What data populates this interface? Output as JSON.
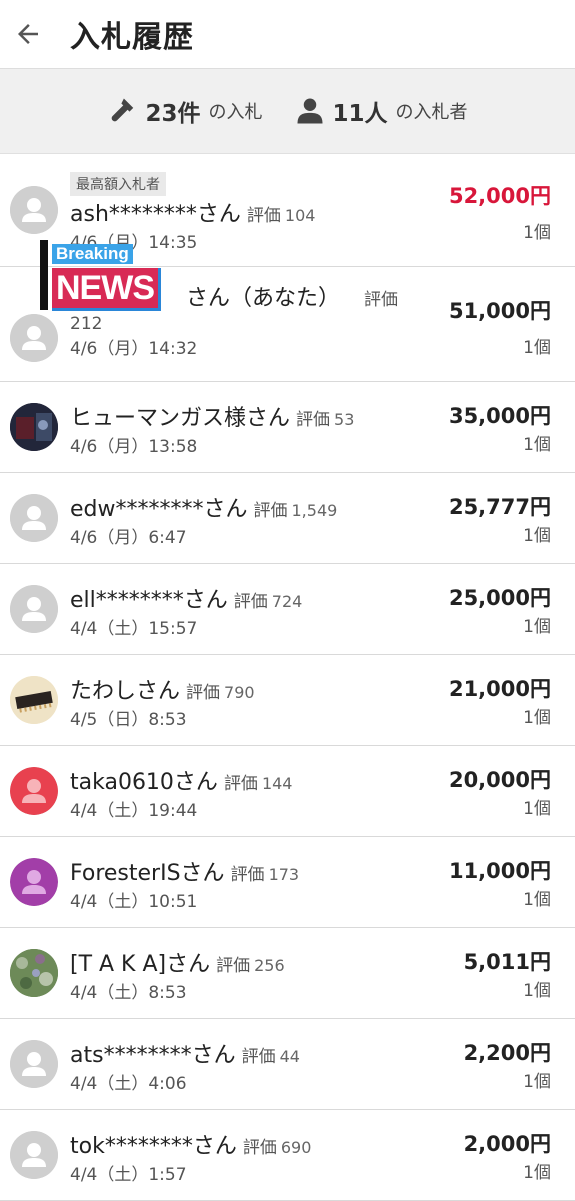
{
  "header": {
    "title": "入札履歴"
  },
  "summary": {
    "count_num": "23件",
    "count_label": "の入札",
    "bidders_num": "11人",
    "bidders_label": "の入札者"
  },
  "top_badge": "最高額入札者",
  "overlay": {
    "breaking": "Breaking",
    "news": "NEWS"
  },
  "bids": [
    {
      "name": "ash********さん",
      "rating_label": "評価",
      "rating": "104",
      "date": "4/6（月）14:35",
      "price": "52,000円",
      "qty": "1個"
    },
    {
      "name": "さん（あなた）",
      "rating_label": "評価",
      "rating": "212",
      "date": "4/6（月）14:32",
      "price": "51,000円",
      "qty": "1個"
    },
    {
      "name": "ヒューマンガス様さん",
      "rating_label": "評価",
      "rating": "53",
      "date": "4/6（月）13:58",
      "price": "35,000円",
      "qty": "1個"
    },
    {
      "name": "edw********さん",
      "rating_label": "評価",
      "rating": "1,549",
      "date": "4/6（月）6:47",
      "price": "25,777円",
      "qty": "1個"
    },
    {
      "name": "ell********さん",
      "rating_label": "評価",
      "rating": "724",
      "date": "4/4（土）15:57",
      "price": "25,000円",
      "qty": "1個"
    },
    {
      "name": "たわしさん",
      "rating_label": "評価",
      "rating": "790",
      "date": "4/5（日）8:53",
      "price": "21,000円",
      "qty": "1個"
    },
    {
      "name": "taka0610さん",
      "rating_label": "評価",
      "rating": "144",
      "date": "4/4（土）19:44",
      "price": "20,000円",
      "qty": "1個"
    },
    {
      "name": "ForesterISさん",
      "rating_label": "評価",
      "rating": "173",
      "date": "4/4（土）10:51",
      "price": "11,000円",
      "qty": "1個"
    },
    {
      "name": "[T A K A]さん",
      "rating_label": "評価",
      "rating": "256",
      "date": "4/4（土）8:53",
      "price": "5,011円",
      "qty": "1個"
    },
    {
      "name": "ats********さん",
      "rating_label": "評価",
      "rating": "44",
      "date": "4/4（土）4:06",
      "price": "2,200円",
      "qty": "1個"
    },
    {
      "name": "tok********さん",
      "rating_label": "評価",
      "rating": "690",
      "date": "4/4（土）1:57",
      "price": "2,000円",
      "qty": "1個"
    }
  ],
  "colors": {
    "highest_price": "#d8163a",
    "summary_bg": "#f0f0f0"
  }
}
